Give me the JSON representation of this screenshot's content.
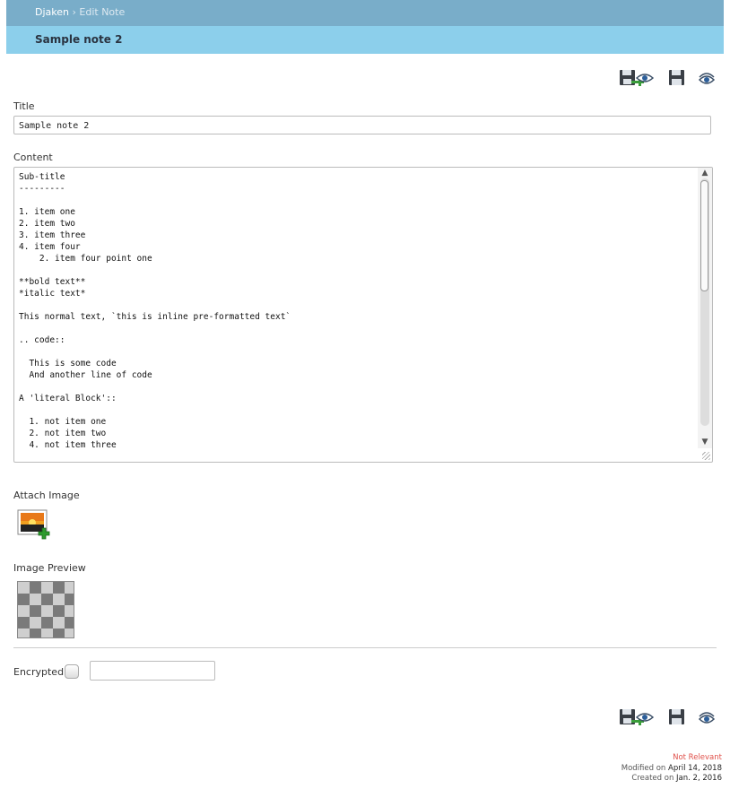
{
  "breadcrumb": {
    "root": "Djaken",
    "separator": "›",
    "current": "Edit Note"
  },
  "page_title": "Sample note 2",
  "toolbar_icons": [
    "save-and-view-icon",
    "save-icon",
    "view-icon"
  ],
  "form": {
    "title_label": "Title",
    "title_value": "Sample note 2",
    "content_label": "Content",
    "content_value": "Sub-title\n---------\n\n1. item one\n2. item two\n3. item three\n4. item four\n    2. item four point one\n\n**bold text**\n*italic text*\n\nThis normal text, `this is inline pre-formatted text`\n\n.. code::\n\n  This is some code\n  And another line of code\n\nA 'literal Block'::\n\n  1. not item one\n  2. not item two\n  4. not item three",
    "attach_image_label": "Attach Image",
    "image_preview_label": "Image Preview",
    "encrypted_label": "Encrypted",
    "encrypted_value": ""
  },
  "footer": {
    "status": "Not Relevant",
    "modified_prefix": "Modified on",
    "modified_date": "April 14, 2018",
    "created_prefix": "Created on",
    "created_date": "Jan. 2, 2016"
  },
  "colors": {
    "header_bar": "#79adc9",
    "title_bar": "#8ccfeb",
    "status_red": "#e0504a"
  }
}
